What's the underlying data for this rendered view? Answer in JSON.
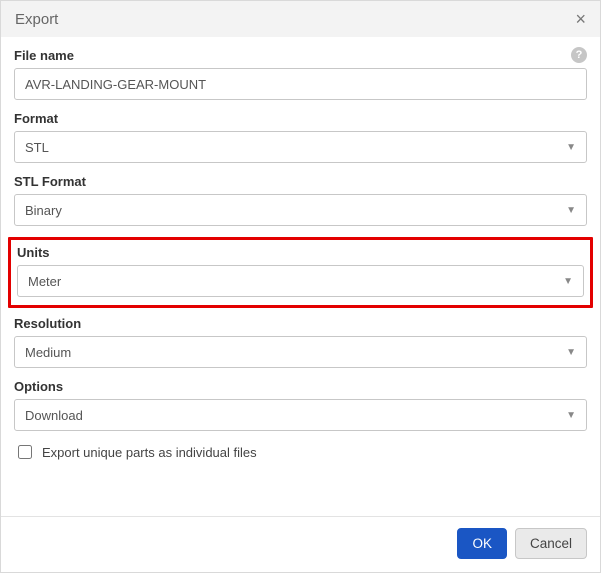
{
  "dialog": {
    "title": "Export"
  },
  "fields": {
    "file_name": {
      "label": "File name",
      "value": "AVR-LANDING-GEAR-MOUNT"
    },
    "format": {
      "label": "Format",
      "value": "STL"
    },
    "stl_format": {
      "label": "STL Format",
      "value": "Binary"
    },
    "units": {
      "label": "Units",
      "value": "Meter"
    },
    "resolution": {
      "label": "Resolution",
      "value": "Medium"
    },
    "options": {
      "label": "Options",
      "value": "Download"
    }
  },
  "checkbox": {
    "label": "Export unique parts as individual files",
    "checked": false
  },
  "buttons": {
    "ok": "OK",
    "cancel": "Cancel"
  }
}
